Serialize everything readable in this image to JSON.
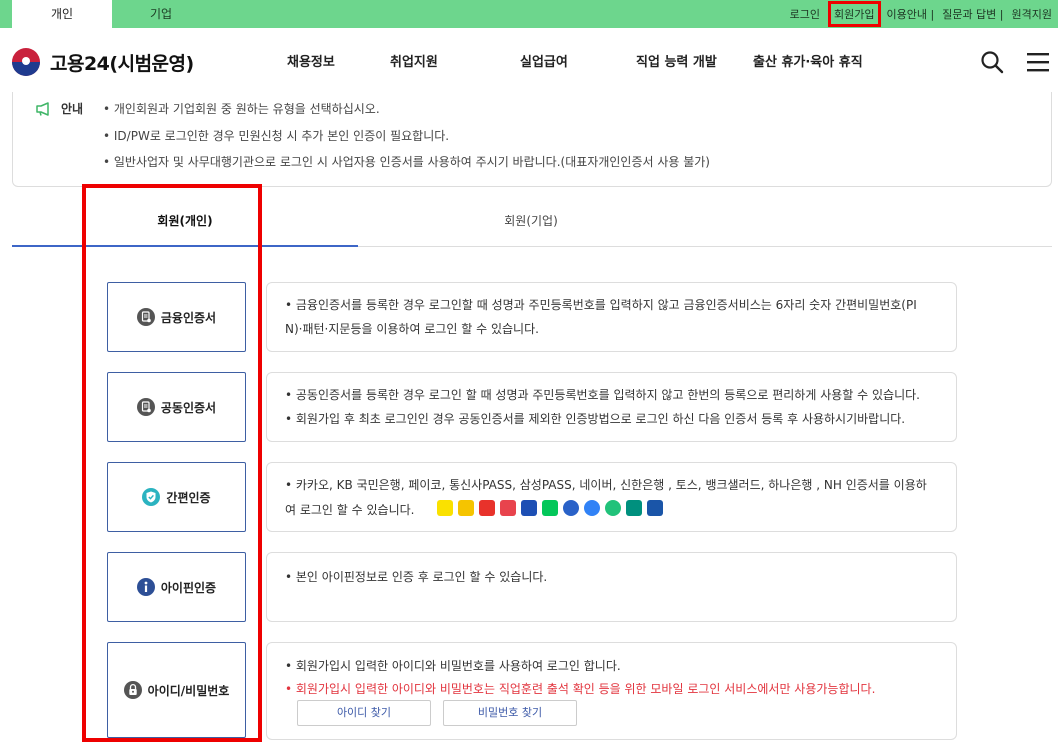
{
  "top_tabs": {
    "personal": "개인",
    "company": "기업"
  },
  "util_nav": {
    "login": "로그인",
    "join": "회원가입",
    "guide": "이용안내 |",
    "qna": "질문과 답변 |",
    "remote": "원격지원"
  },
  "header": {
    "logo_text": "고용24(시범운영)",
    "nav": [
      "채용정보",
      "취업지원",
      "실업급여",
      "직업 능력 개발",
      "출산 휴가·육아 휴직"
    ]
  },
  "notice": {
    "label": "안내",
    "lines": [
      "• 개인회원과 기업회원 중 원하는 유형을 선택하십시오.",
      "• ID/PW로 로그인한 경우 민원신청 시 추가 본인 인증이 필요합니다.",
      "• 일반사업자 및 사무대행기관으로 로그인 시 사업자용 인증서를 사용하여 주시기 바랍니다.(대표자개인인증서 사용 불가)"
    ]
  },
  "member_tabs": {
    "personal": "회원(개인)",
    "company": "회원(기업)"
  },
  "auth_methods": [
    {
      "label": "금융인증서",
      "icon": "financial-cert-icon",
      "lines": [
        "• 금융인증서를 등록한 경우 로그인할 때 성명과 주민등록번호를 입력하지 않고 금융인증서비스는 6자리 숫자 간편비밀번호(PI",
        "N)·패턴·지문등을 이용하여 로그인 할 수 있습니다."
      ]
    },
    {
      "label": "공동인증서",
      "icon": "joint-cert-icon",
      "lines": [
        "• 공동인증서를 등록한 경우 로그인 할 때 성명과 주민등록번호를 입력하지 않고 한번의 등록으로 편리하게 사용할 수 있습니다.",
        "• 회원가입 후 최초 로그인인 경우 공동인증서를 제외한 인증방법으로 로그인 하신 다음 인증서 등록 후 사용하시기바랍니다."
      ]
    },
    {
      "label": "간편인증",
      "icon": "shield-check-icon",
      "lines": [
        "• 카카오, KB 국민은행, 페이코, 통신사PASS, 삼성PASS, 네이버, 신한은행 , 토스, 뱅크샐러드, 하나은행 , NH 인증서를 이용하",
        "여 로그인 할 수 있습니다."
      ]
    },
    {
      "label": "아이핀인증",
      "icon": "info-icon",
      "lines": [
        "• 본인 아이핀정보로 인증 후 로그인 할 수 있습니다."
      ]
    },
    {
      "label": "아이디/비밀번호",
      "icon": "lock-icon",
      "lines": [
        "• 회원가입시 입력한 아이디와 비밀번호를 사용하여 로그인 합니다.",
        "• 회원가입시 입력한 아이디와 비밀번호는 직업훈련 출석 확인 등을 위한 모바일 로그인 서비스에서만 사용가능합니다."
      ],
      "buttons": {
        "find_id": "아이디 찾기",
        "find_pw": "비밀번호 찾기"
      }
    }
  ],
  "simple_auth_icons": [
    {
      "name": "kakao-icon",
      "color": "#fae100"
    },
    {
      "name": "kb-icon",
      "color": "#f5c400"
    },
    {
      "name": "payco-icon",
      "color": "#e8322b"
    },
    {
      "name": "pass-icon",
      "color": "#e8434d"
    },
    {
      "name": "samsung-pass-icon",
      "color": "#1d4fb4"
    },
    {
      "name": "naver-icon",
      "color": "#03c75a"
    },
    {
      "name": "shinhan-icon",
      "color": "#2a62c8"
    },
    {
      "name": "toss-icon",
      "color": "#3182f6"
    },
    {
      "name": "banksalad-icon",
      "color": "#21c27a"
    },
    {
      "name": "hana-icon",
      "color": "#00907e"
    },
    {
      "name": "nh-icon",
      "color": "#1a55a8"
    }
  ],
  "colors": {
    "accent_green": "#6dd68d",
    "accent_blue": "#3d66c7",
    "highlight_red": "#ee0000",
    "warning_red": "#e2343e"
  }
}
